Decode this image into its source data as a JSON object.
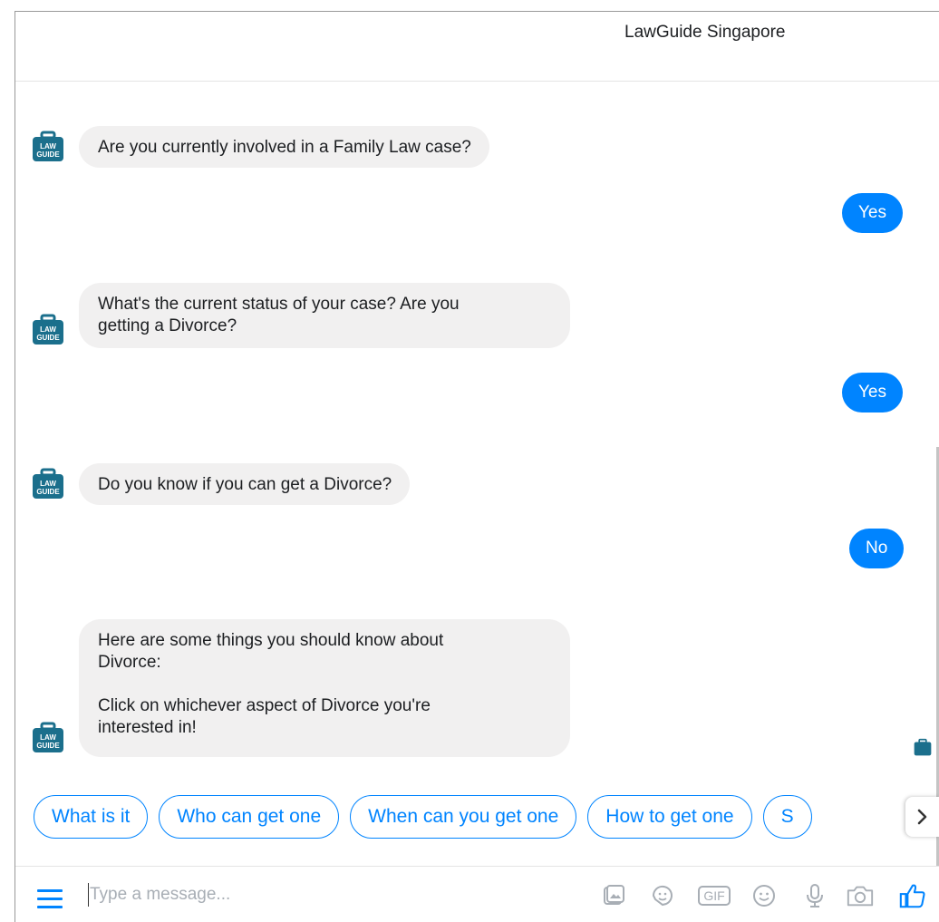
{
  "header": {
    "title": "LawGuide Singapore"
  },
  "avatar_text": "LAW GUIDE",
  "messages": [
    {
      "from": "bot",
      "text": "Are you currently involved in a Family Law case?"
    },
    {
      "from": "user",
      "text": "Yes"
    },
    {
      "from": "bot",
      "text": "What's the current status of your case? Are you\ngetting a Divorce?"
    },
    {
      "from": "user",
      "text": "Yes"
    },
    {
      "from": "bot",
      "text": "Do you know if you can get a Divorce?"
    },
    {
      "from": "user",
      "text": "No"
    },
    {
      "from": "bot",
      "text": "Here are some things you should know about\nDivorce:\n\nClick on whichever aspect of Divorce you're\ninterested in!"
    }
  ],
  "quick_replies": [
    "What is it",
    "Who can get one",
    "When can you get one",
    "How to get one",
    "S"
  ],
  "quick_replies_next_icon": "chevron-right-icon",
  "composer": {
    "placeholder": "Type a message...",
    "icons": [
      "menu-icon",
      "image-icon",
      "sticker-icon",
      "gif-icon",
      "emoji-icon",
      "microphone-icon",
      "camera-icon",
      "thumbs-up-icon"
    ],
    "gif_label": "GIF"
  },
  "colors": {
    "accent": "#0084ff",
    "bot_bubble": "#f1f0f0",
    "avatar": "#1b6f8c"
  }
}
